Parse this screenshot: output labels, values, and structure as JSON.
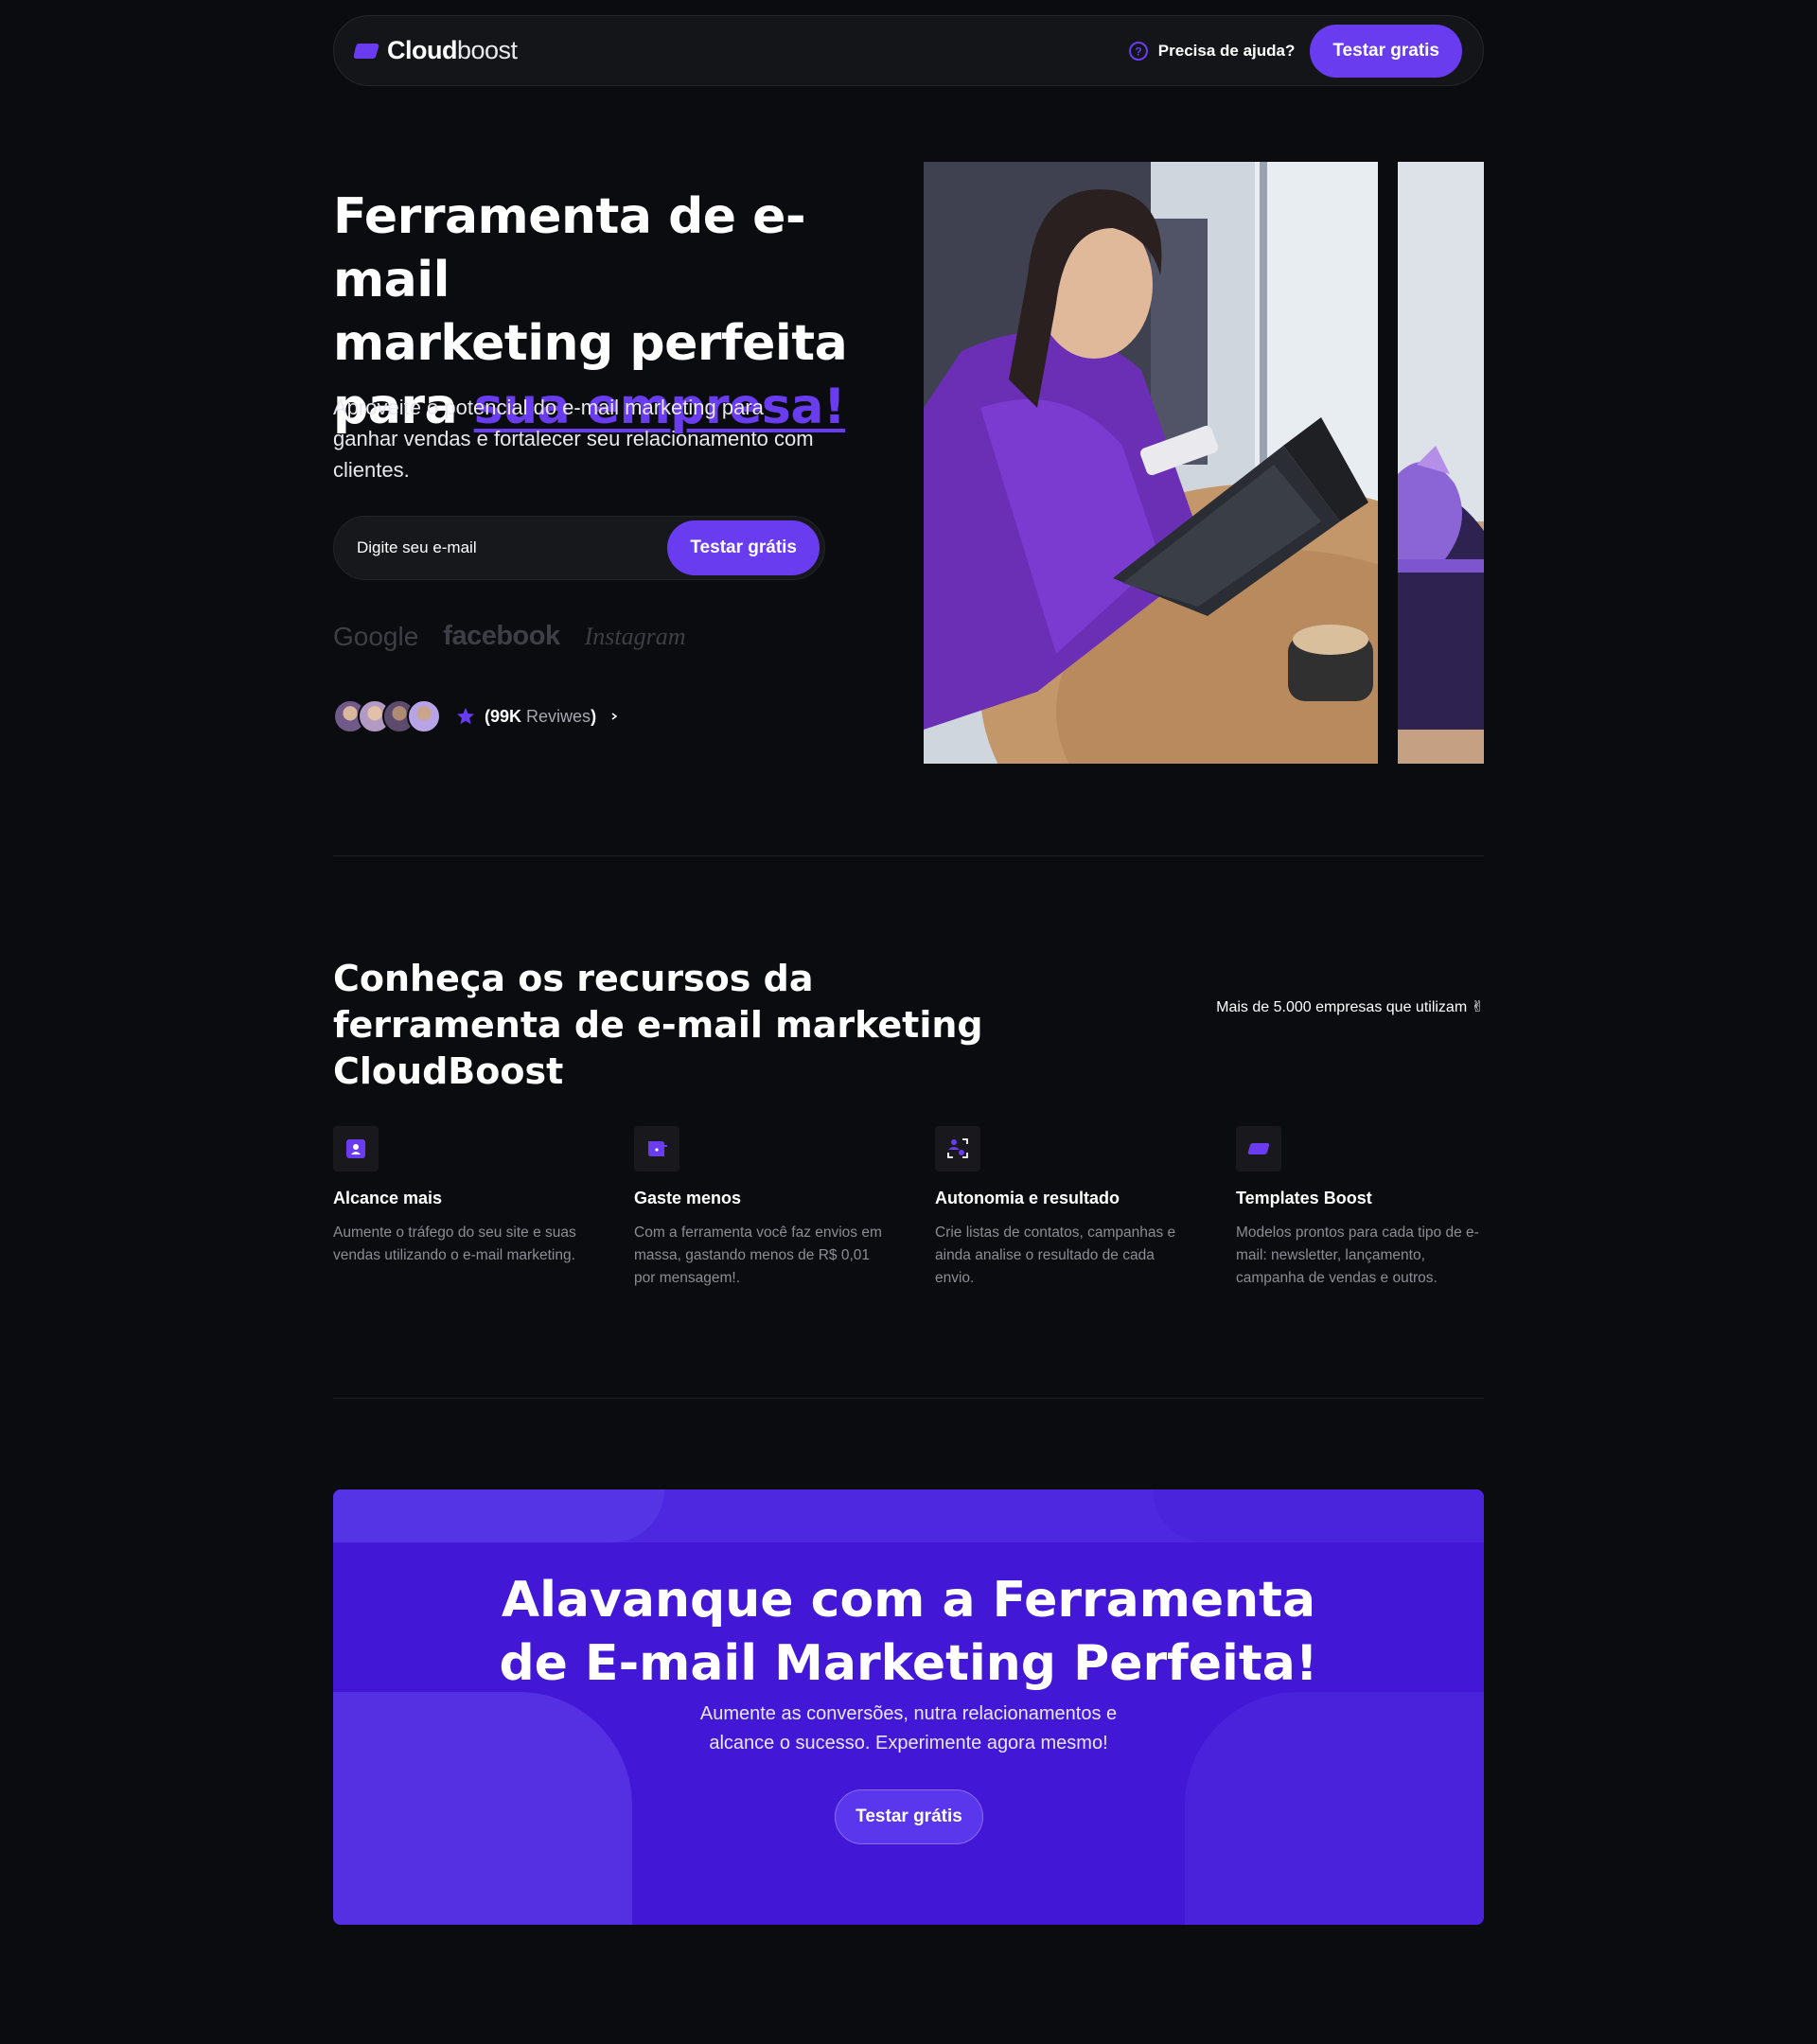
{
  "nav": {
    "logo_bold": "Cloud",
    "logo_light": "boost",
    "help_label": "Precisa de ajuda?",
    "cta_label": "Testar gratis"
  },
  "hero": {
    "title_line1": "Ferramenta de e-mail",
    "title_line2": "marketing perfeita",
    "title_line3_prefix": "para ",
    "title_accent": "sua empresa!",
    "subtitle": "Aproveite o potencial do e-mail marketing para ganhar vendas e fortalecer seu relacionamento com clientes.",
    "email_placeholder": "Digite seu e-mail",
    "cta_label": "Testar grátis",
    "brands": [
      "Google",
      "facebook",
      "Instagram"
    ],
    "reviews_count": "(99K",
    "reviews_word": "Reviwes",
    "reviews_close": ")"
  },
  "features": {
    "title": "Conheça os recursos da ferramenta de e-mail marketing CloudBoost",
    "note": "Mais de 5.000 empresas que utilizam ✌",
    "items": [
      {
        "icon": "user-badge-icon",
        "title": "Alcance mais",
        "text": "Aumente o tráfego do seu site e suas vendas utilizando o e-mail marketing."
      },
      {
        "icon": "wallet-icon",
        "title": "Gaste menos",
        "text": "Com a ferramenta você faz envios em massa, gastando menos de R$ 0,01 por mensagem!."
      },
      {
        "icon": "user-scan-icon",
        "title": "Autonomia e resultado",
        "text": "Crie listas de contatos, campanhas e ainda analise o resultado de cada envio."
      },
      {
        "icon": "cloud-shape-icon",
        "title": "Templates Boost",
        "text": "Modelos prontos para cada tipo de e-mail: newsletter, lançamento, campanha de vendas e outros."
      }
    ]
  },
  "cta": {
    "title_line1": "Alavanque com a Ferramenta",
    "title_line2": "de E-mail Marketing Perfeita!",
    "subtitle_line1": "Aumente as conversões, nutra relacionamentos e",
    "subtitle_line2": "alcance o sucesso. Experimente agora mesmo!",
    "button_label": "Testar grátis"
  },
  "colors": {
    "background": "#0b0c0f",
    "accent": "#6a3cf0",
    "cta_background": "#4218d6"
  }
}
